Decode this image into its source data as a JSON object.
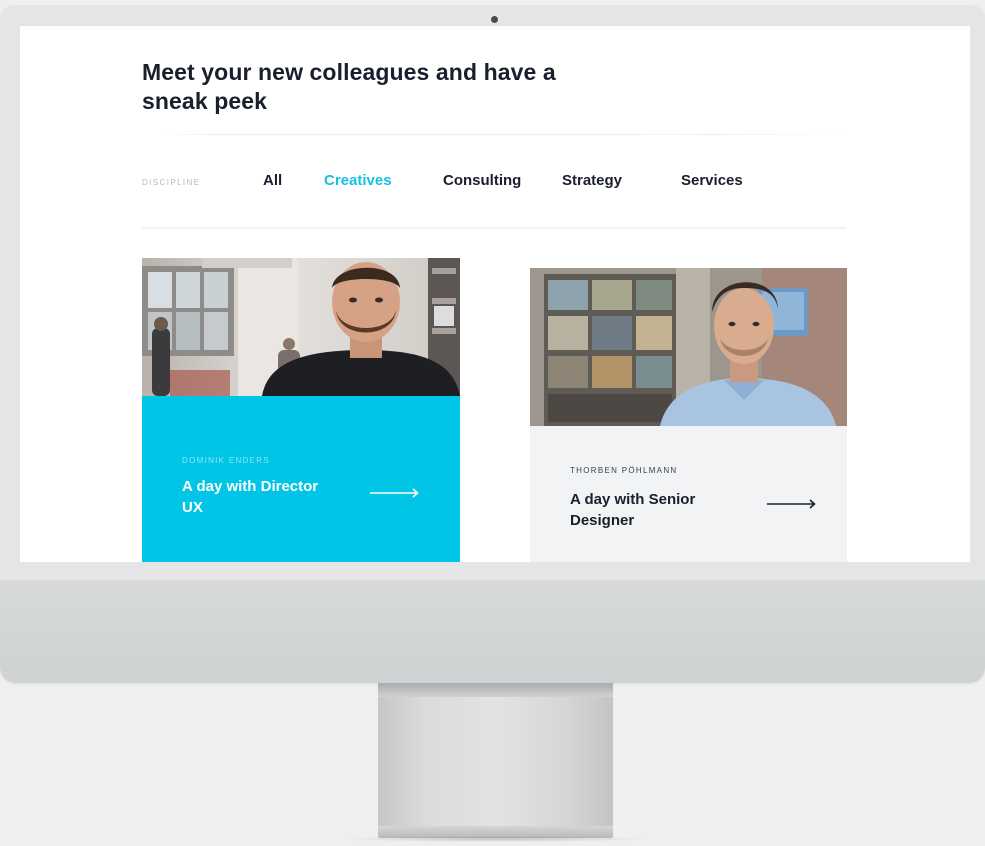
{
  "page": {
    "headline": "Meet your new colleagues and have a sneak peek"
  },
  "filter": {
    "label": "DISCIPLINE",
    "tabs": [
      {
        "label": "All",
        "active": false
      },
      {
        "label": "Creatives",
        "active": true
      },
      {
        "label": "Consulting",
        "active": false
      },
      {
        "label": "Strategy",
        "active": false
      },
      {
        "label": "Services",
        "active": false
      }
    ]
  },
  "cards": [
    {
      "name": "DOMINIK ENDERS",
      "title": "A day with Director UX",
      "background_color": "#00c5e6",
      "arrow_icon": "long-arrow-right-icon"
    },
    {
      "name": "THORBEN PÖHLMANN",
      "title": "A day with Senior Designer",
      "background_color": "#f2f3f4",
      "arrow_icon": "long-arrow-right-icon"
    }
  ],
  "colors": {
    "accent": "#17c0e0",
    "text_dark": "#1a1f2e"
  }
}
